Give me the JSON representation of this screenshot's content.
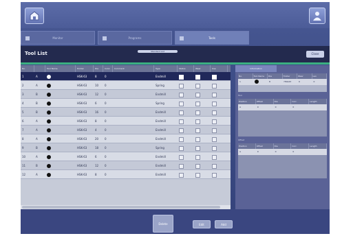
{
  "header": {
    "home_icon": "home-icon",
    "user_icon": "user-icon"
  },
  "tabs": [
    {
      "label": "Monitor",
      "icon": "monitor-icon"
    },
    {
      "label": "Programs",
      "icon": "programs-icon"
    },
    {
      "label": "Tools",
      "icon": "tools-icon"
    }
  ],
  "titlebar": {
    "title": "Tool List",
    "center_label": "Standard List",
    "right_button": "Close"
  },
  "table": {
    "columns": [
      "No.",
      "",
      "Tool Name",
      "Holder",
      "Dia",
      "Color",
      "Comment",
      "Type",
      "Status",
      "Wear",
      "Use"
    ],
    "rows": [
      {
        "no": "1",
        "pos": "A",
        "holder": "HSK-63",
        "dia": "8",
        "d2": "0",
        "type": "Endmill",
        "selected": true
      },
      {
        "no": "2",
        "pos": "A",
        "holder": "HSK-63",
        "dia": "10",
        "d2": "0",
        "type": "Spring",
        "selected": false
      },
      {
        "no": "3",
        "pos": "B",
        "holder": "HSK-63",
        "dia": "12",
        "d2": "0",
        "type": "Endmill",
        "selected": false
      },
      {
        "no": "4",
        "pos": "B",
        "holder": "HSK-63",
        "dia": "6",
        "d2": "0",
        "type": "Spring",
        "selected": false
      },
      {
        "no": "5",
        "pos": "B",
        "holder": "HSK-63",
        "dia": "16",
        "d2": "0",
        "type": "Endmill",
        "selected": false
      },
      {
        "no": "6",
        "pos": "A",
        "holder": "HSK-63",
        "dia": "8",
        "d2": "0",
        "type": "Endmill",
        "selected": false
      },
      {
        "no": "7",
        "pos": "A",
        "holder": "HSK-63",
        "dia": "4",
        "d2": "0",
        "type": "Endmill",
        "selected": false
      },
      {
        "no": "8",
        "pos": "A",
        "holder": "HSK-63",
        "dia": "20",
        "d2": "0",
        "type": "Endmill",
        "selected": false
      },
      {
        "no": "9",
        "pos": "B",
        "holder": "HSK-63",
        "dia": "18",
        "d2": "0",
        "type": "Spring",
        "selected": false
      },
      {
        "no": "10",
        "pos": "A",
        "holder": "HSK-63",
        "dia": "6",
        "d2": "0",
        "type": "Endmill",
        "selected": false
      },
      {
        "no": "11",
        "pos": "B",
        "holder": "HSK-63",
        "dia": "12",
        "d2": "0",
        "type": "Endmill",
        "selected": false
      },
      {
        "no": "12",
        "pos": "A",
        "holder": "HSK-63",
        "dia": "8",
        "d2": "0",
        "type": "Endmill",
        "selected": false
      }
    ]
  },
  "right_panel": {
    "tab_label": "Information",
    "top_columns": [
      "No.",
      "Tool Name",
      "Dia",
      "Holder",
      "Wear",
      "Len"
    ],
    "top_row": [
      "1",
      "",
      "8",
      "HSK-63",
      "0",
      "0"
    ],
    "section2_label": "Tool",
    "section2_columns": [
      "Position",
      "Offset",
      "Dia",
      "Corr.",
      "Length"
    ],
    "section2_row": [
      "A",
      "0",
      "0",
      "0",
      ""
    ],
    "section3_label": "Offset",
    "section3_columns": [
      "Position",
      "Offset",
      "Dia",
      "Corr.",
      "Length"
    ],
    "section3_row": [
      "A",
      "0",
      "0",
      "0",
      ""
    ]
  },
  "bottom_buttons": [
    "Delete",
    "Edit",
    "Add"
  ]
}
